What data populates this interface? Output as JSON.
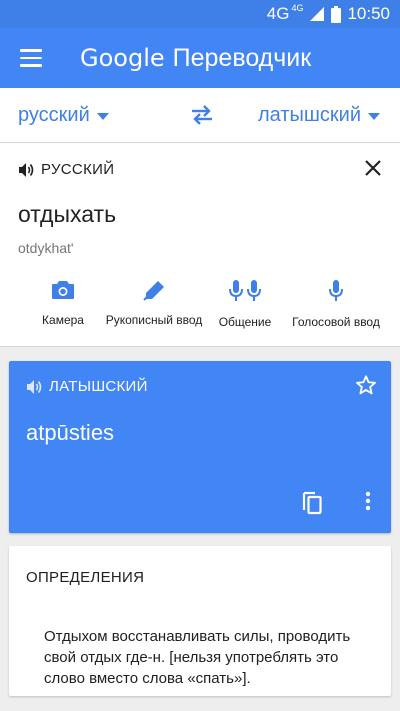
{
  "status": {
    "network": "4G",
    "network_small": "4G",
    "time": "10:50"
  },
  "header": {
    "logo": "Google",
    "title": "Переводчик"
  },
  "languages": {
    "source": "русский",
    "target": "латышский"
  },
  "input": {
    "lang_label": "РУССКИЙ",
    "text": "отдыхать",
    "transliteration": "otdykhat'"
  },
  "tools": [
    {
      "label": "Камера"
    },
    {
      "label": "Рукописный ввод"
    },
    {
      "label": "Общение"
    },
    {
      "label": "Голосовой ввод"
    }
  ],
  "output": {
    "lang_label": "ЛАТЫШСКИЙ",
    "text": "atpūsties"
  },
  "definitions": {
    "title": "ОПРЕДЕЛЕНИЯ",
    "text": "Отдыхом восстанавливать силы, проводить свой отдых где-н. [нельзя употреблять это слово вместо слова «спать»]."
  },
  "colors": {
    "primary": "#4285f4",
    "status": "#3f7fe8",
    "icon": "#3f7fe8"
  }
}
